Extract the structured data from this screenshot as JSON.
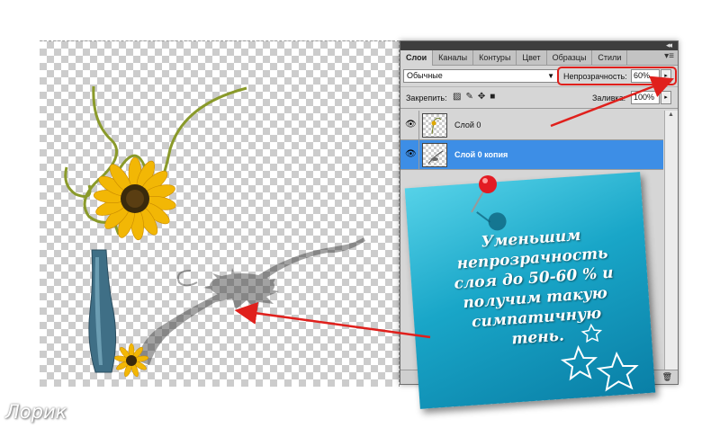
{
  "panel": {
    "tabs": [
      "Слои",
      "Каналы",
      "Контуры",
      "Цвет",
      "Образцы",
      "Стили"
    ],
    "collapse_glyph": "◂◂",
    "menu_glyph": "▾≡",
    "blend_mode": "Обычные",
    "opacity_label": "Непрозрачность:",
    "opacity_value": "60%",
    "lock_label": "Закрепить:",
    "fill_label": "Заливка:",
    "fill_value": "100%",
    "layers": [
      {
        "name": "Слой 0",
        "selected": false
      },
      {
        "name": "Слой 0 копия",
        "selected": true
      }
    ],
    "highlight_color": "#e0201c",
    "selected_color": "#3d8ee6"
  },
  "note": {
    "lines": [
      "Уменьшим",
      "непрозрачность",
      "слоя до 50-60 % и",
      "получим такую",
      "симпатичную",
      "тень."
    ],
    "color": "#19a6c8",
    "pin_color": "#e31b23"
  },
  "watermark": "Лорик",
  "icons": [
    "eye-icon",
    "lock-pixels-icon",
    "brush-icon",
    "move-icon",
    "lock-icon",
    "trash-icon",
    "pushpin-icon",
    "star-icon"
  ]
}
